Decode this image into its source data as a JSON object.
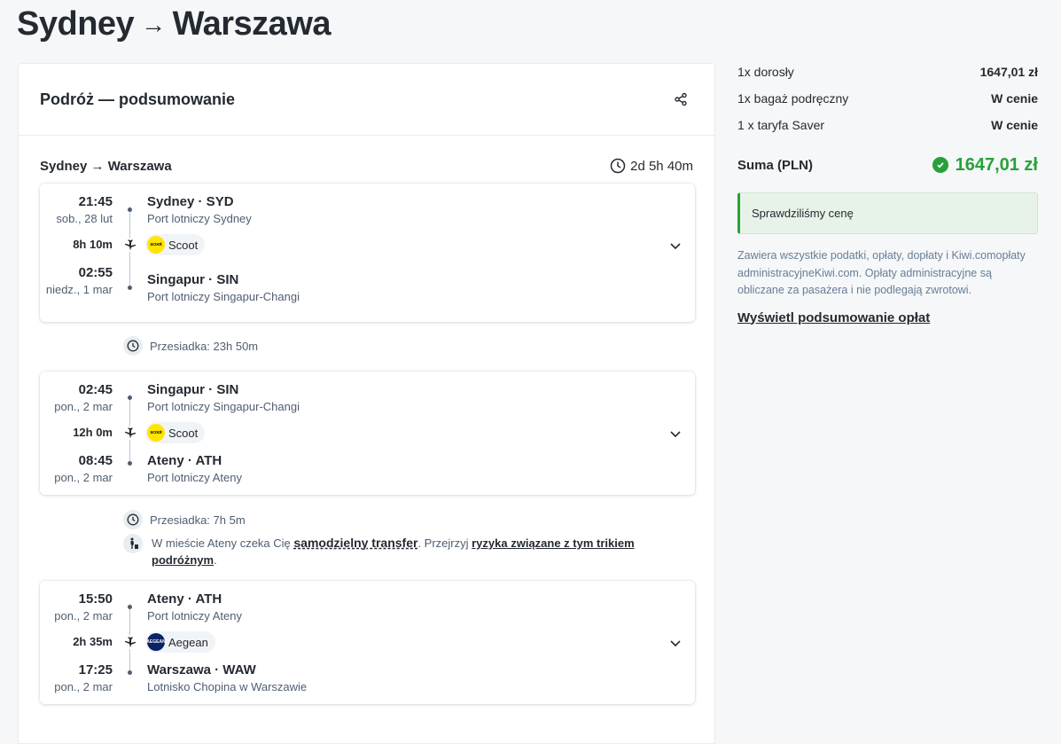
{
  "page": {
    "origin": "Sydney",
    "arrow": "→",
    "destination": "Warszawa"
  },
  "card": {
    "title": "Podróż — podsumowanie"
  },
  "trip": {
    "route": "Sydney → Warszawa",
    "duration": "2d 5h 40m"
  },
  "segments": [
    {
      "dep_time": "21:45",
      "dep_date": "sob., 28 lut",
      "dep_city": "Sydney · SYD",
      "dep_airport": "Port lotniczy Sydney",
      "duration": "8h 10m",
      "carrier": "Scoot",
      "carrier_logo": "scoot",
      "arr_time": "02:55",
      "arr_date": "niedz., 1 mar",
      "arr_city": "Singapur · SIN",
      "arr_airport": "Port lotniczy Singapur-Changi"
    },
    {
      "dep_time": "02:45",
      "dep_date": "pon., 2 mar",
      "dep_city": "Singapur · SIN",
      "dep_airport": "Port lotniczy Singapur-Changi",
      "duration": "12h 0m",
      "carrier": "Scoot",
      "carrier_logo": "scoot",
      "arr_time": "08:45",
      "arr_date": "pon., 2 mar",
      "arr_city": "Ateny · ATH",
      "arr_airport": "Port lotniczy Ateny"
    },
    {
      "dep_time": "15:50",
      "dep_date": "pon., 2 mar",
      "dep_city": "Ateny · ATH",
      "dep_airport": "Port lotniczy Ateny",
      "duration": "2h 35m",
      "carrier": "Aegean",
      "carrier_logo": "AEGEAN",
      "arr_time": "17:25",
      "arr_date": "pon., 2 mar",
      "arr_city": "Warszawa · WAW",
      "arr_airport": "Lotnisko Chopina w Warszawie"
    }
  ],
  "layovers": [
    {
      "text": "Przesiadka: 23h 50m"
    },
    {
      "text": "Przesiadka: 7h 5m"
    }
  ],
  "transfer": {
    "prefix": "W mieście Ateny czeka Cię ",
    "link1": "samodzielny transfer",
    "middle": ". Przejrzyj ",
    "link2": "ryzyka związane z tym trikiem podróżnym",
    "suffix": "."
  },
  "pricing": {
    "rows": [
      {
        "label": "1x dorosły",
        "value": "1647,01 zł"
      },
      {
        "label": "1x bagaż podręczny",
        "value": "W cenie"
      },
      {
        "label": "1 x taryfa Saver",
        "value": "W cenie"
      }
    ],
    "total_label": "Suma (PLN)",
    "total_value": "1647,01 zł",
    "alert": "Sprawdziliśmy cenę",
    "fine_print": "Zawiera wszystkie podatki, opłaty, dopłaty i Kiwi.comopłaty administracyjneKiwi.com. Opłaty administracyjne są obliczane za pasażera i nie podlegają zwrotowi.",
    "fees_link": "Wyświetl podsumowanie opłat"
  },
  "colors": {
    "success": "#28a138",
    "text": "#252a31",
    "muted": "#4f5e71",
    "scoot": "#ffe500",
    "aegean": "#0b2265"
  }
}
